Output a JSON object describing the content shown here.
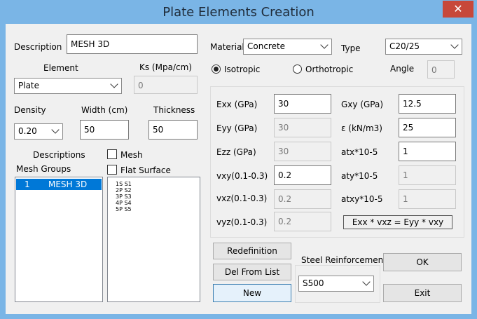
{
  "window": {
    "title": "Plate Elements Creation",
    "close_glyph": "✕"
  },
  "left": {
    "description_label": "Description",
    "description_value": "MESH 3D",
    "element_label": "Element",
    "element_value": "Plate",
    "ks_label": "Ks (Mpa/cm)",
    "ks_value": "0",
    "density_label": "Density",
    "density_value": "0.20",
    "width_label": "Width (cm)",
    "width_value": "50",
    "thickness_label": "Thickness",
    "thickness_value": "50",
    "descriptions_label": "Descriptions",
    "mesh_groups_label": "Mesh Groups",
    "mesh_checkbox_label": "Mesh",
    "flat_surface_label": "Flat Surface",
    "mesh_group_row": {
      "index": "1",
      "name": "MESH 3D"
    },
    "surfaces": [
      "1S S1",
      "2P S2",
      "3P S3",
      "4P S4",
      "5P S5"
    ]
  },
  "right": {
    "material_label": "Material",
    "material_value": "Concrete",
    "type_label": "Type",
    "type_value": "C20/25",
    "isotropic_label": "Isotropic",
    "orthotropic_label": "Orthotropic",
    "angle_label": "Angle",
    "angle_value": "0",
    "props": {
      "exx_label": "Exx (GPa)",
      "exx_value": "30",
      "eyy_label": "Eyy (GPa)",
      "eyy_value": "30",
      "ezz_label": "Ezz (GPa)",
      "ezz_value": "30",
      "vxy_label": "vxy(0.1-0.3)",
      "vxy_value": "0.2",
      "vxz_label": "vxz(0.1-0.3)",
      "vxz_value": "0.2",
      "vyz_label": "vyz(0.1-0.3)",
      "vyz_value": "0.2",
      "gxy_label": "Gxy (GPa)",
      "gxy_value": "12.5",
      "eps_label": "ε (kN/m3)",
      "eps_value": "25",
      "atx_label": "atx*10-5",
      "atx_value": "1",
      "aty_label": "aty*10-5",
      "aty_value": "1",
      "atxy_label": "atxy*10-5",
      "atxy_value": "1",
      "formula": "Exx * vxz = Eyy * vxy"
    }
  },
  "buttons": {
    "redefinition": "Redefinition",
    "del_from_list": "Del From List",
    "new": "New",
    "ok": "OK",
    "exit": "Exit"
  },
  "steel": {
    "label": "Steel Reinforcement",
    "value": "S500"
  }
}
